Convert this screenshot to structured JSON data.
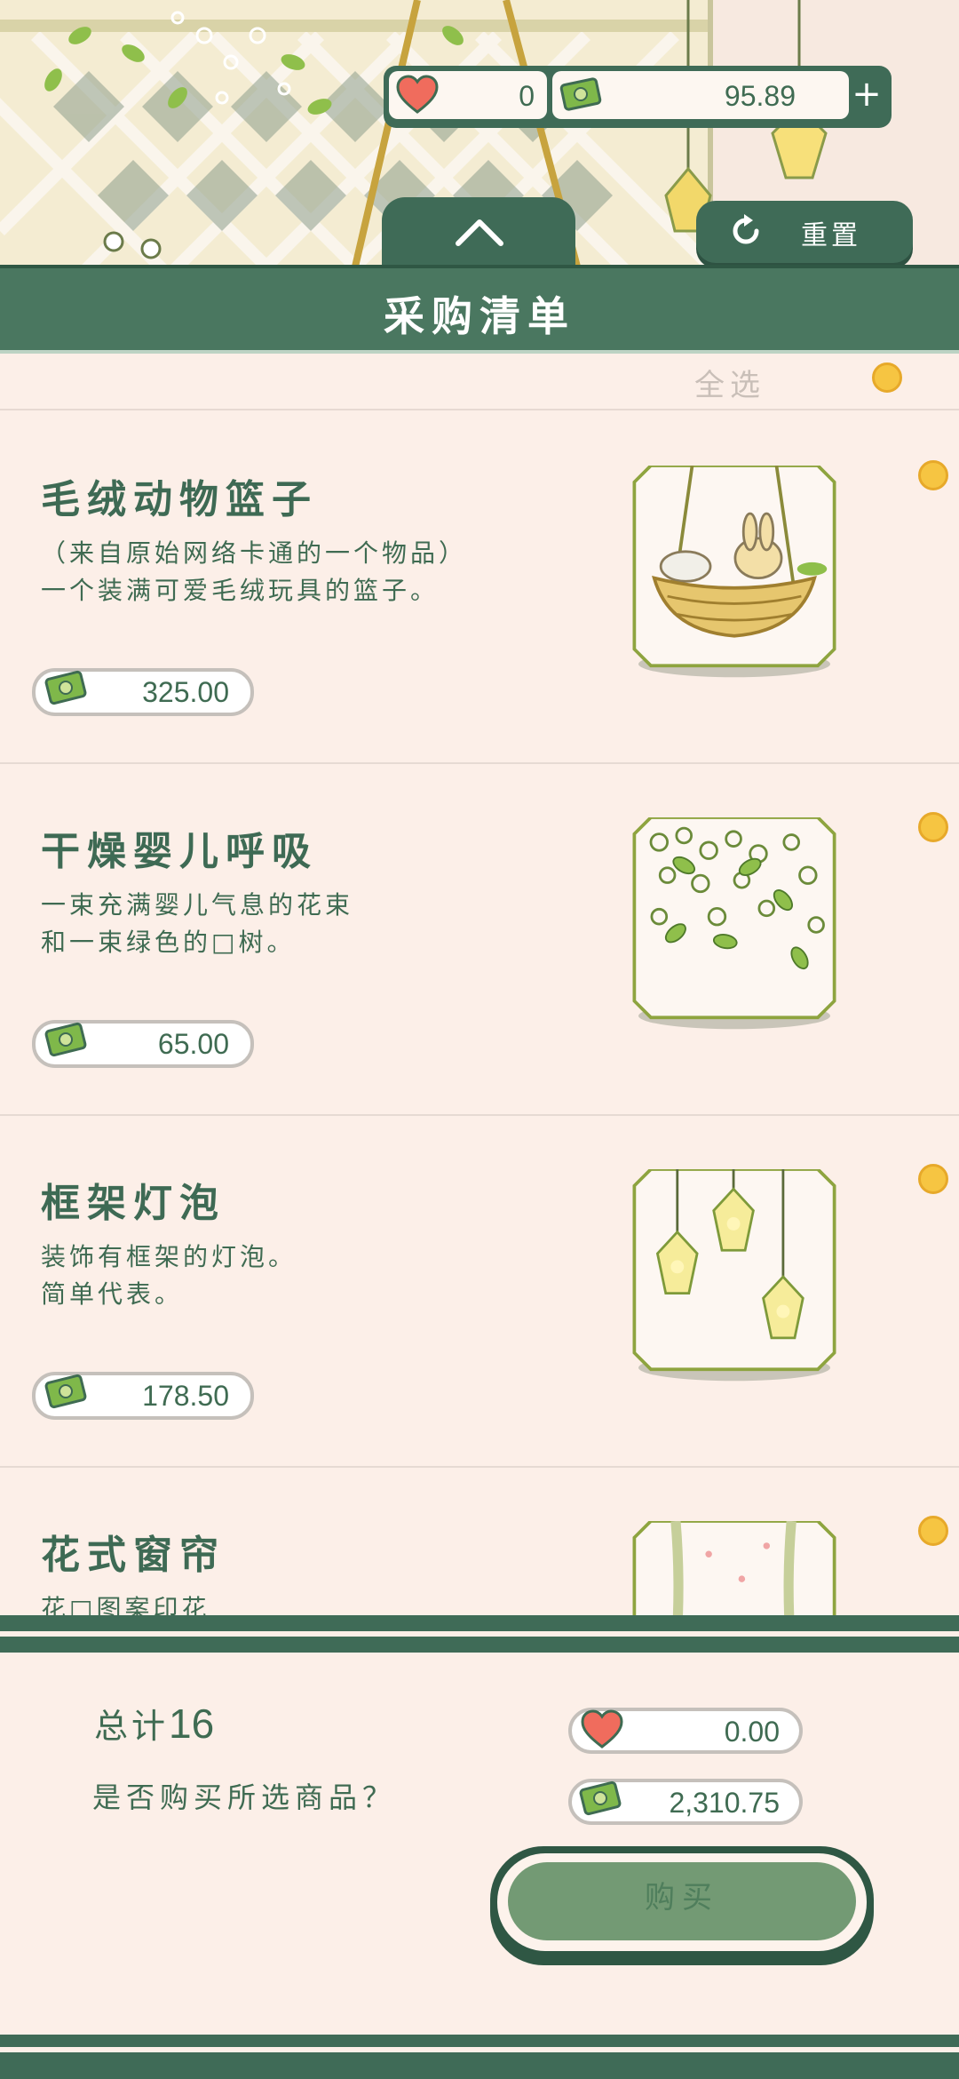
{
  "hud": {
    "hearts_value": "0",
    "cash_value": "95.89",
    "add_label": "+",
    "reset_label": "重置"
  },
  "header": {
    "title": "采购清单"
  },
  "select_all": {
    "label": "全选"
  },
  "items": [
    {
      "name": "毛绒动物篮子",
      "desc_line1": "（来自原始网络卡通的一个物品）",
      "desc_line2": "一个装满可爱毛绒玩具的篮子。",
      "price": "325.00",
      "thumb_icon": "plush-basket-icon"
    },
    {
      "name": "干燥婴儿呼吸",
      "desc_line1": "一束充满婴儿气息的花束",
      "desc_line2": "和一束绿色的□树。",
      "price": "65.00",
      "thumb_icon": "babys-breath-icon"
    },
    {
      "name": "框架灯泡",
      "desc_line1": "装饰有框架的灯泡。",
      "desc_line2": "简单代表。",
      "price": "178.50",
      "thumb_icon": "frame-bulb-icon"
    },
    {
      "name": "花式窗帘",
      "desc_line1": "花□图案印花",
      "desc_line2": "",
      "price": "",
      "thumb_icon": "curtain-icon"
    }
  ],
  "footer": {
    "total_label": "总计",
    "total_count": "16",
    "question": "是否购买所选商品？",
    "heart_cost": "0.00",
    "cash_cost": "2,310.75",
    "buy_label": "购买"
  },
  "colors": {
    "primary": "#3f6b57",
    "background": "#fcefe8",
    "accent_yellow": "#f6c542",
    "buy_green": "#739a74"
  }
}
